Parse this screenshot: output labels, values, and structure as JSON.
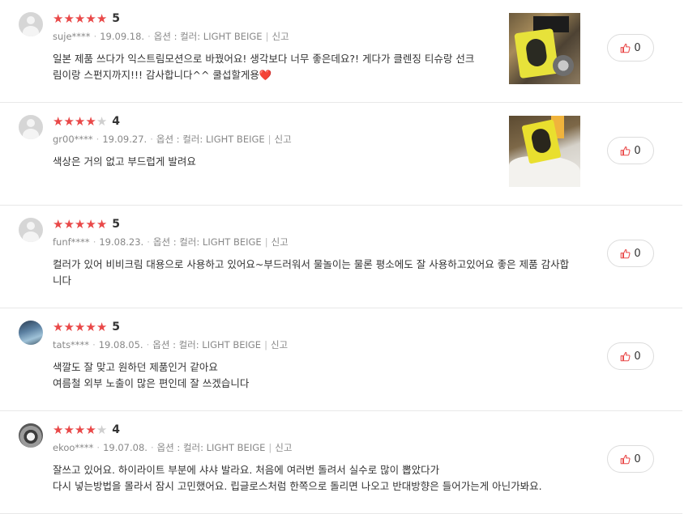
{
  "reviews": [
    {
      "score": "5",
      "rating": 5,
      "user": "suje****",
      "date": "19.09.18.",
      "option_label": "옵션 : 컬러: LIGHT BEIGE",
      "report_label": "신고",
      "text": [
        "일본 제품 쓰다가 익스트림모션으로 바꿨어요! 생각보다 너무 좋은데요?! 게다가 클렌징 티슈랑 선크",
        "림이랑 스펀지까지!!! 감사합니다^^ 쿨섭할게용❤️"
      ],
      "has_photo": true,
      "likes": "0",
      "avatar": "default"
    },
    {
      "score": "4",
      "rating": 4,
      "user": "gr00****",
      "date": "19.09.27.",
      "option_label": "옵션 : 컬러: LIGHT BEIGE",
      "report_label": "신고",
      "text": [
        "색상은 거의 없고 부드럽게 발려요"
      ],
      "has_photo": true,
      "likes": "0",
      "avatar": "default"
    },
    {
      "score": "5",
      "rating": 5,
      "user": "funf****",
      "date": "19.08.23.",
      "option_label": "옵션 : 컬러: LIGHT BEIGE",
      "report_label": "신고",
      "text": [
        "컬러가 있어 비비크림 대용으로 사용하고 있어요~부드러워서 물놀이는 물론 평소에도 잘 사용하고있어요 좋은 제품 감사합",
        "니다"
      ],
      "has_photo": false,
      "likes": "0",
      "avatar": "default"
    },
    {
      "score": "5",
      "rating": 5,
      "user": "tats****",
      "date": "19.08.05.",
      "option_label": "옵션 : 컬러: LIGHT BEIGE",
      "report_label": "신고",
      "text": [
        "색깔도 잘 맞고 원하던 제품인거 같아요",
        "여름철 외부 노출이 많은 편인데 잘 쓰겠습니다"
      ],
      "has_photo": false,
      "likes": "0",
      "avatar": "photo"
    },
    {
      "score": "4",
      "rating": 4,
      "user": "ekoo****",
      "date": "19.07.08.",
      "option_label": "옵션 : 컬러: LIGHT BEIGE",
      "report_label": "신고",
      "text": [
        "잘쓰고 있어요. 하이라이트 부분에 샤샤 발라요. 처음에 여러번 돌려서 실수로 많이 뽑았다가",
        "다시 넣는방법을 몰라서 잠시 고민했어요. 립글로스처럼 한쪽으로 돌리면 나오고 반대방향은 들어가는게 아닌가봐요."
      ],
      "has_photo": false,
      "likes": "0",
      "avatar": "photo"
    }
  ],
  "colors": {
    "star_on": "#e94848",
    "star_off": "#cfcfcf",
    "like_icon": "#e94848"
  },
  "icons": {
    "like": "thumbs-up-icon",
    "avatar_default": "user-silhouette-icon"
  }
}
